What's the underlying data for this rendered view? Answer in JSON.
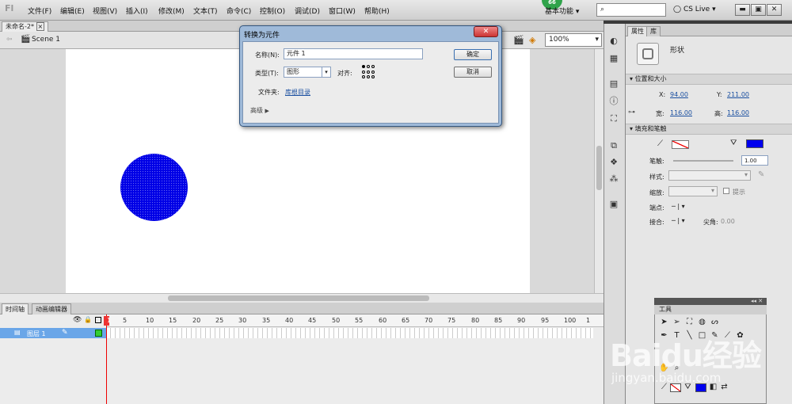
{
  "app": {
    "logo": "Fl"
  },
  "menu": [
    "文件(F)",
    "编辑(E)",
    "视图(V)",
    "插入(I)",
    "修改(M)",
    "文本(T)",
    "命令(C)",
    "控制(O)",
    "调试(D)",
    "窗口(W)",
    "帮助(H)"
  ],
  "topbar": {
    "badge": "66",
    "workspace": "基本功能",
    "search_placeholder": "",
    "cslive": "CS Live"
  },
  "document": {
    "tab": "未命名-2*",
    "tab_close": "×",
    "scene": "Scene 1",
    "zoom": "100%"
  },
  "timeline": {
    "tabs": [
      "时间轴",
      "动画编辑器"
    ],
    "ticks": [
      "1",
      "5",
      "10",
      "15",
      "20",
      "25",
      "30",
      "35",
      "40",
      "45",
      "50",
      "55",
      "60",
      "65",
      "70",
      "75",
      "80",
      "85",
      "90",
      "95",
      "100",
      "1"
    ],
    "layer": "图层 1"
  },
  "dialog": {
    "title": "转换为元件",
    "name_label": "名称(N):",
    "name_value": "元件 1",
    "type_label": "类型(T):",
    "type_value": "图形",
    "align_label": "对齐:",
    "folder_label": "文件夹:",
    "folder_link": "库根目录",
    "advanced": "高级",
    "ok": "确定",
    "cancel": "取消"
  },
  "properties": {
    "tabs": [
      "属性",
      "库"
    ],
    "shape_label": "形状",
    "section_pos": "位置和大小",
    "x_label": "X:",
    "x_value": "94.00",
    "y_label": "Y:",
    "y_value": "211.00",
    "w_label": "宽:",
    "w_value": "116.00",
    "h_label": "高:",
    "h_value": "116.00",
    "section_fill": "填充和笔触",
    "stroke_label": "笔触:",
    "stroke_value": "1.00",
    "style_label": "样式:",
    "scale_label": "缩放:",
    "hint_label": "提示",
    "cap_label": "端点:",
    "join_label": "接合:",
    "miter_label": "尖角:",
    "miter_value": "0.00",
    "fill_color": "#0000ee"
  },
  "tools": {
    "title": "工具"
  },
  "watermark": {
    "line1": "Baidu经验",
    "line2": "jingyan.baidu.com"
  },
  "colors": {
    "circle": "#0000e6",
    "dialog_frame": "#9fbad9",
    "selected_layer": "#6aa6e8"
  }
}
